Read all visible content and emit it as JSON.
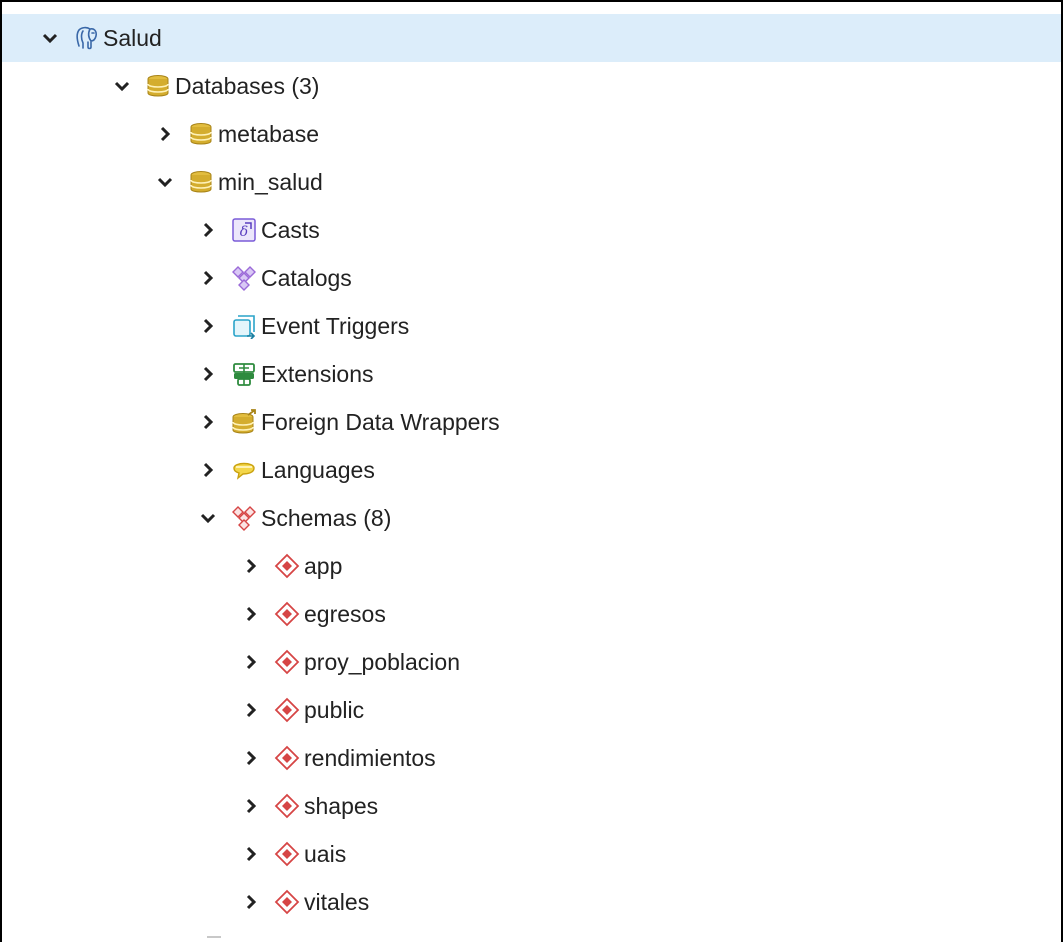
{
  "tree": {
    "server": {
      "label": "Salud",
      "icon": "postgres-elephant-icon",
      "expanded": true,
      "selected": true
    },
    "databases": {
      "label": "Databases (3)",
      "icon": "database-icon",
      "expanded": true
    },
    "db_metabase": {
      "label": "metabase",
      "icon": "database-icon",
      "expanded": false
    },
    "db_min_salud": {
      "label": "min_salud",
      "icon": "database-icon",
      "expanded": true
    },
    "casts": {
      "label": "Casts",
      "icon": "casts-icon",
      "expanded": false
    },
    "catalogs": {
      "label": "Catalogs",
      "icon": "catalogs-icon",
      "expanded": false
    },
    "event_triggers": {
      "label": "Event Triggers",
      "icon": "event-triggers-icon",
      "expanded": false
    },
    "extensions": {
      "label": "Extensions",
      "icon": "extensions-icon",
      "expanded": false
    },
    "fdw": {
      "label": "Foreign Data Wrappers",
      "icon": "foreign-data-wrapper-icon",
      "expanded": false
    },
    "languages": {
      "label": "Languages",
      "icon": "languages-icon",
      "expanded": false
    },
    "schemas": {
      "label": "Schemas (8)",
      "icon": "schemas-icon",
      "expanded": true,
      "items": [
        {
          "label": "app",
          "icon": "schema-icon"
        },
        {
          "label": "egresos",
          "icon": "schema-icon"
        },
        {
          "label": "proy_poblacion",
          "icon": "schema-icon"
        },
        {
          "label": "public",
          "icon": "schema-icon"
        },
        {
          "label": "rendimientos",
          "icon": "schema-icon"
        },
        {
          "label": "shapes",
          "icon": "schema-icon"
        },
        {
          "label": "uais",
          "icon": "schema-icon"
        },
        {
          "label": "vitales",
          "icon": "schema-icon"
        }
      ]
    }
  },
  "colors": {
    "selected_row": "#dcedfa",
    "text": "#222222",
    "database_gold": "#c9a227",
    "schema_red": "#d64545",
    "casts_purple": "#7a5bd8",
    "catalog_purple": "#9b6ad8",
    "event_teal": "#2aa3c9",
    "extension_green": "#2e8b3e",
    "language_yellow": "#e8c21a"
  }
}
